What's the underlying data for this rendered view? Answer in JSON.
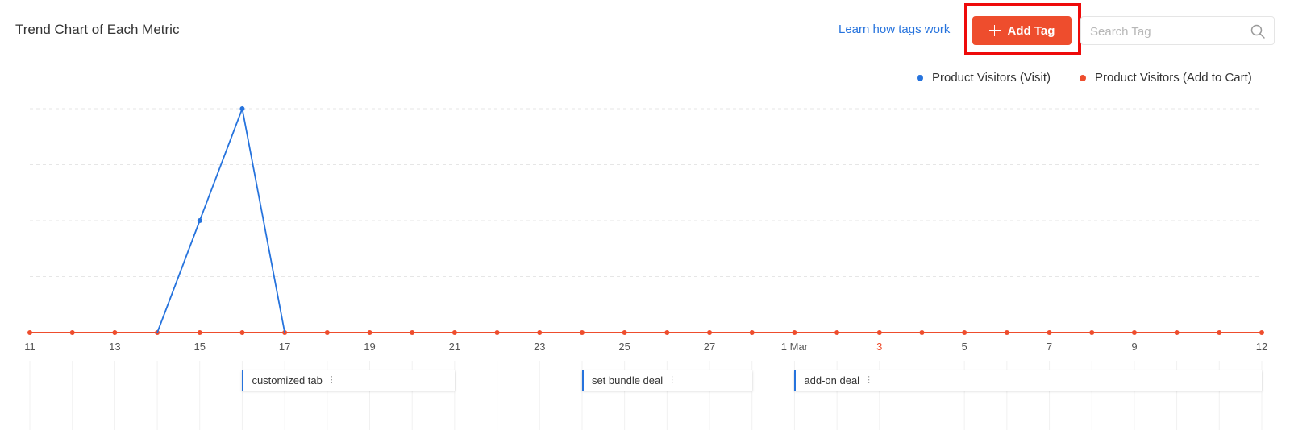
{
  "header": {
    "title": "Trend Chart of Each Metric",
    "learn_link": "Learn how tags work",
    "add_tag_label": "Add Tag",
    "search_placeholder": "Search Tag"
  },
  "colors": {
    "visit": "#2673dd",
    "add_to_cart": "#ee4d2d",
    "highlight_frame": "#ee0a0a"
  },
  "chart_data": {
    "type": "line",
    "x": [
      "11",
      "12",
      "13",
      "14",
      "15",
      "16",
      "17",
      "18",
      "19",
      "20",
      "21",
      "22",
      "23",
      "24",
      "25",
      "26",
      "27",
      "28",
      "1 Mar",
      "2",
      "3",
      "4",
      "5",
      "6",
      "7",
      "8",
      "9",
      "10",
      "11",
      "12"
    ],
    "tick_labels": [
      "11",
      "13",
      "15",
      "17",
      "19",
      "21",
      "23",
      "25",
      "27",
      "1 Mar",
      "3",
      "5",
      "7",
      "9",
      "12"
    ],
    "highlighted_tick": "3",
    "series": [
      {
        "name": "Product Visitors (Visit)",
        "color": "#2673dd",
        "values": [
          0,
          0,
          0,
          0,
          1,
          2,
          0,
          0,
          0,
          0,
          0,
          0,
          0,
          0,
          0,
          0,
          0,
          0,
          0,
          0,
          0,
          0,
          0,
          0,
          0,
          0,
          0,
          0,
          0,
          0
        ]
      },
      {
        "name": "Product Visitors (Add to Cart)",
        "color": "#ee4d2d",
        "values": [
          0,
          0,
          0,
          0,
          0,
          0,
          0,
          0,
          0,
          0,
          0,
          0,
          0,
          0,
          0,
          0,
          0,
          0,
          0,
          0,
          0,
          0,
          0,
          0,
          0,
          0,
          0,
          0,
          0,
          0
        ]
      }
    ],
    "ylim": [
      0,
      2
    ],
    "grid": true,
    "legend": "top-right",
    "y_ticks_shown": false
  },
  "tags": [
    {
      "label": "customized tab",
      "start": "16",
      "end": "21"
    },
    {
      "label": "set bundle deal",
      "start": "24",
      "end": "28"
    },
    {
      "label": "add-on deal",
      "start": "1 Mar",
      "end": "12"
    }
  ]
}
